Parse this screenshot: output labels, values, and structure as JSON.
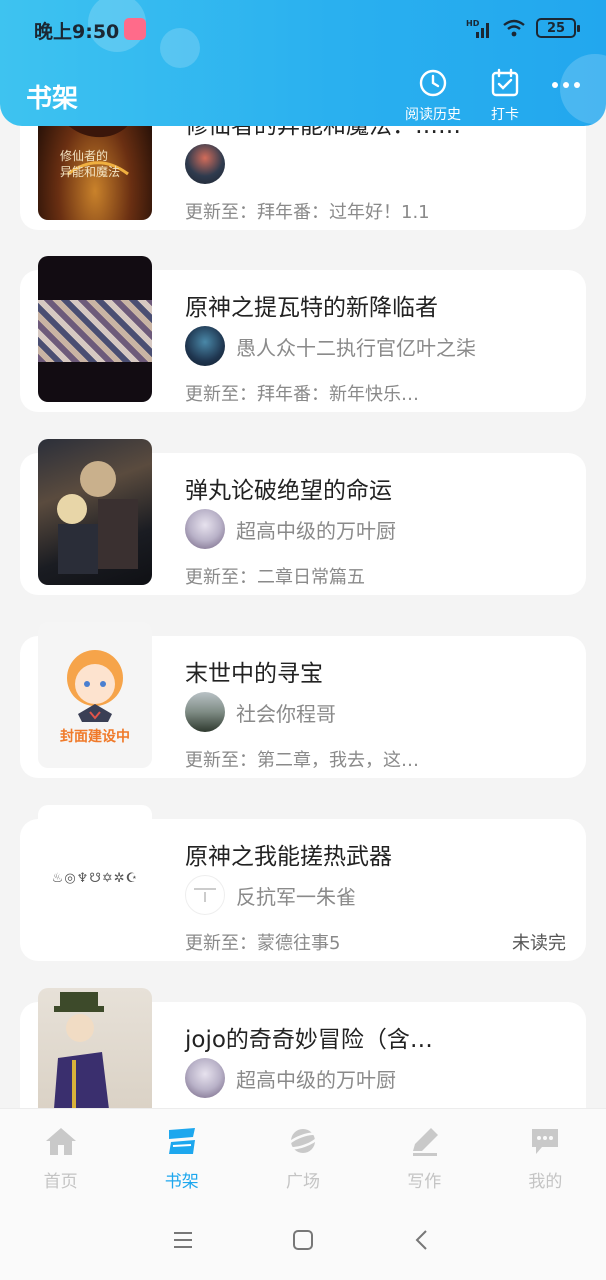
{
  "status_bar": {
    "time": "晚上9:50",
    "network": "HD",
    "battery": "25"
  },
  "header": {
    "title": "书架",
    "actions": [
      {
        "label": "阅读历史",
        "icon": "clock-icon"
      },
      {
        "label": "打卡",
        "icon": "calendar-check-icon"
      }
    ],
    "more_icon": "more-dots-icon"
  },
  "books": [
    {
      "title": "修仙者的异能和魔法：……",
      "cover_text": "修仙者的\n异能和魔法",
      "author": "",
      "update": "更新至：拜年番：过年好！1.1",
      "status": ""
    },
    {
      "title": "原神之提瓦特的新降临者",
      "cover_text": "",
      "author": "愚人众十二执行官亿叶之柒",
      "update": "更新至：拜年番：新年快乐…",
      "status": ""
    },
    {
      "title": "弹丸论破绝望的命运",
      "cover_text": "",
      "author": "超高中级的万叶厨",
      "update": "更新至：二章日常篇五",
      "status": ""
    },
    {
      "title": "末世中的寻宝",
      "cover_text": "封面建设中",
      "author": "社会你程哥",
      "update": "更新至：第二章，我去，这…",
      "status": ""
    },
    {
      "title": "原神之我能搓热武器",
      "cover_text": "",
      "author": "反抗军一朱雀",
      "update": "更新至：蒙德往事5",
      "status": "未读完"
    },
    {
      "title": "jojo的奇奇妙冒险（含…",
      "cover_text": "",
      "author": "超高中级的万叶厨",
      "update": "",
      "status": ""
    }
  ],
  "bottom_nav": [
    {
      "label": "首页",
      "icon": "home-icon",
      "active": false
    },
    {
      "label": "书架",
      "icon": "bookshelf-icon",
      "active": true
    },
    {
      "label": "广场",
      "icon": "planet-icon",
      "active": false
    },
    {
      "label": "写作",
      "icon": "pen-icon",
      "active": false
    },
    {
      "label": "我的",
      "icon": "chat-bubble-icon",
      "active": false
    }
  ],
  "colors": {
    "header": "#2ab0ef",
    "accent": "#1da7ee",
    "inactive": "#c4c4c4"
  }
}
